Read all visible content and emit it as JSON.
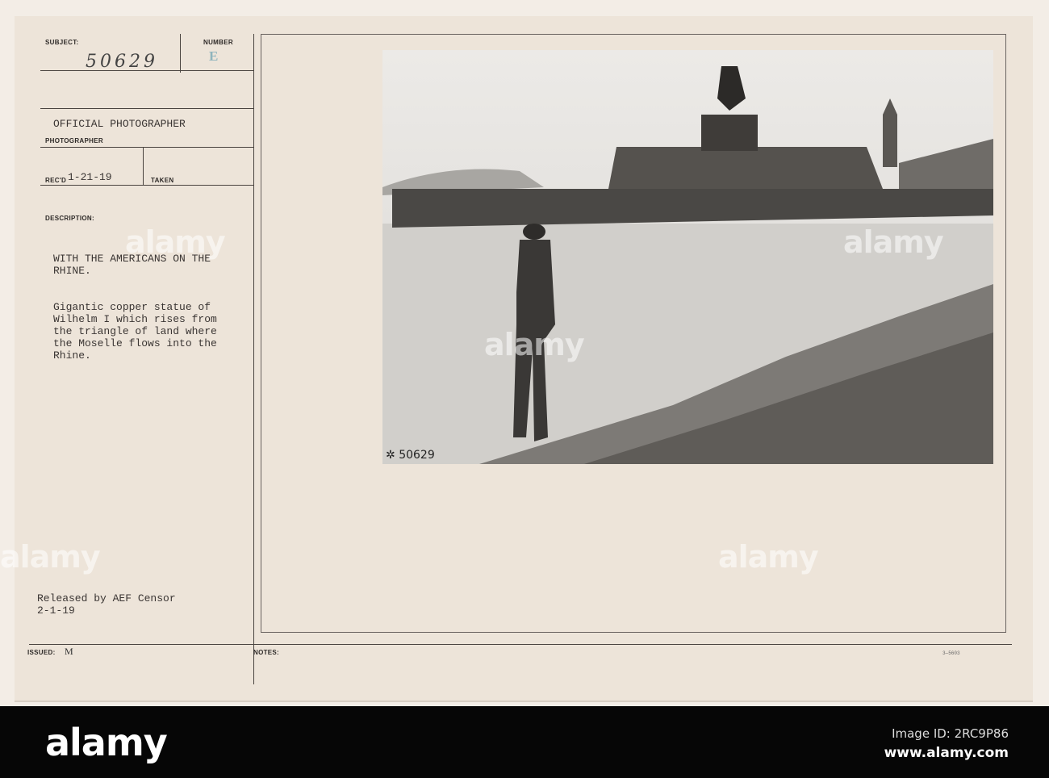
{
  "card": {
    "subject_label": "SUBJECT:",
    "subject_number": "50629",
    "number_label": "NUMBER",
    "number_stamp": "E",
    "photographer_value": "OFFICIAL PHOTOGRAPHER",
    "photographer_label": "PHOTOGRAPHER",
    "recd_label": "REC'D",
    "recd_value": "1-21-19",
    "taken_label": "TAKEN",
    "description_label": "DESCRIPTION:",
    "description_heading": "WITH THE AMERICANS ON THE\nRHINE.",
    "description_body": "Gigantic copper statue of\nWilhelm I which rises from\nthe triangle of land where\nthe Moselle flows into the\nRhine.",
    "released": "Released by AEF Censor\n2-1-19",
    "issued_label": "ISSUED:",
    "issued_value": "M",
    "notes_label": "NOTES:",
    "form_number": "3—5603",
    "photo_number": "50629"
  },
  "watermark": "alamy",
  "footer": {
    "logo": "alamy",
    "image_id": "Image ID: 2RC9P86",
    "url": "www.alamy.com"
  }
}
